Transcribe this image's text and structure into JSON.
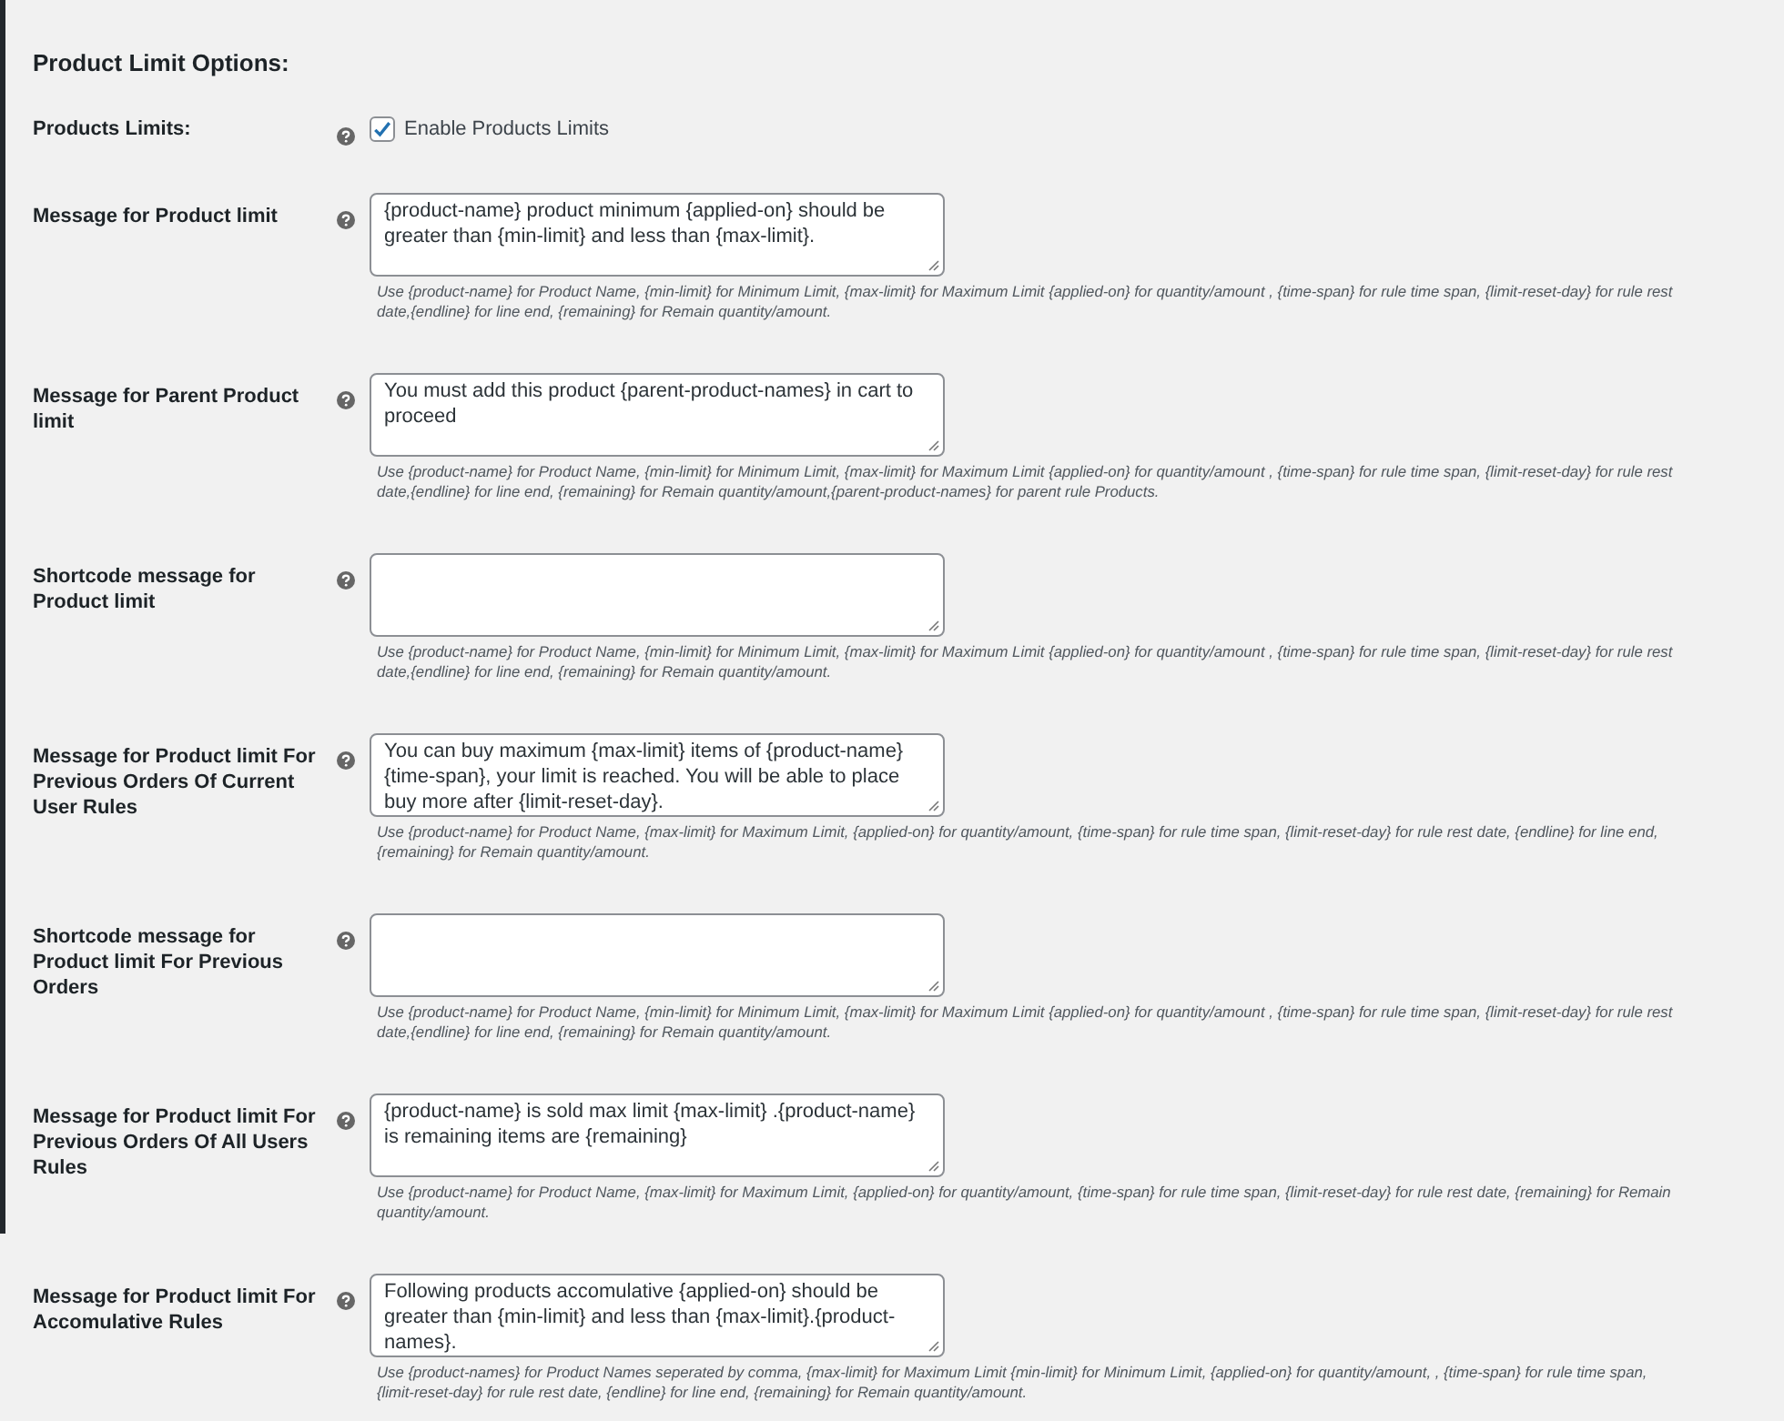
{
  "title": "Product Limit Options:",
  "toggle": {
    "label": "Products Limits:",
    "checkbox_label": "Enable Products Limits",
    "checked": true
  },
  "messages": [
    {
      "label": "Message for Product limit",
      "value": "{product-name} product minimum {applied-on} should be greater than {min-limit} and less than {max-limit}.",
      "description": "Use {product-name} for Product Name, {min-limit} for Minimum Limit, {max-limit} for Maximum Limit {applied-on} for quantity/amount , {time-span} for rule time span, {limit-reset-day} for rule rest date,{endline} for line end, {remaining} for Remain quantity/amount."
    },
    {
      "label": "Message for Parent Product limit",
      "value": "You must add this product {parent-product-names} in cart to proceed",
      "description": "Use {product-name} for Product Name, {min-limit} for Minimum Limit, {max-limit} for Maximum Limit {applied-on} for quantity/amount , {time-span} for rule time span, {limit-reset-day} for rule rest date,{endline} for line end, {remaining} for Remain quantity/amount,{parent-product-names} for parent rule Products."
    },
    {
      "label": "Shortcode message for Product limit",
      "description": "Use {product-name} for Product Name, {min-limit} for Minimum Limit, {max-limit} for Maximum Limit {applied-on} for quantity/amount , {time-span} for rule time span, {limit-reset-day} for rule rest date,{endline} for line end, {remaining} for Remain quantity/amount."
    },
    {
      "label": "Message for Product limit For Previous Orders Of Current User Rules",
      "value": "You can buy maximum {max-limit} items of {product-name} {time-span}, your limit is reached. You will be able to place buy more after {limit-reset-day}.",
      "description": "Use {product-name} for Product Name, {max-limit} for Maximum Limit, {applied-on} for quantity/amount, {time-span} for rule time span, {limit-reset-day} for rule rest date, {endline} for line end, {remaining} for Remain quantity/amount."
    },
    {
      "label": "Shortcode message for Product limit For Previous Orders",
      "description": "Use {product-name} for Product Name, {min-limit} for Minimum Limit, {max-limit} for Maximum Limit {applied-on} for quantity/amount , {time-span} for rule time span, {limit-reset-day} for rule rest date,{endline} for line end, {remaining} for Remain quantity/amount."
    },
    {
      "label": "Message for Product limit For Previous Orders Of All Users Rules",
      "value": "{product-name} is sold max limit {max-limit} .{product-name} is remaining items are {remaining}",
      "description": "Use {product-name} for Product Name, {max-limit} for Maximum Limit, {applied-on} for quantity/amount, {time-span} for rule time span, {limit-reset-day} for rule rest date, {remaining} for Remain quantity/amount."
    },
    {
      "label": "Message for Product limit For Accomulative Rules",
      "value": "Following products accomulative {applied-on} should be greater than {min-limit} and less than {max-limit}.{product-names}.",
      "description": "Use {product-names} for Product Names seperated by comma, {max-limit} for Maximum Limit {min-limit} for Minimum Limit, {applied-on} for quantity/amount, , {time-span} for rule time span, {limit-reset-day} for rule rest date, {endline} for line end, {remaining} for Remain quantity/amount."
    }
  ]
}
